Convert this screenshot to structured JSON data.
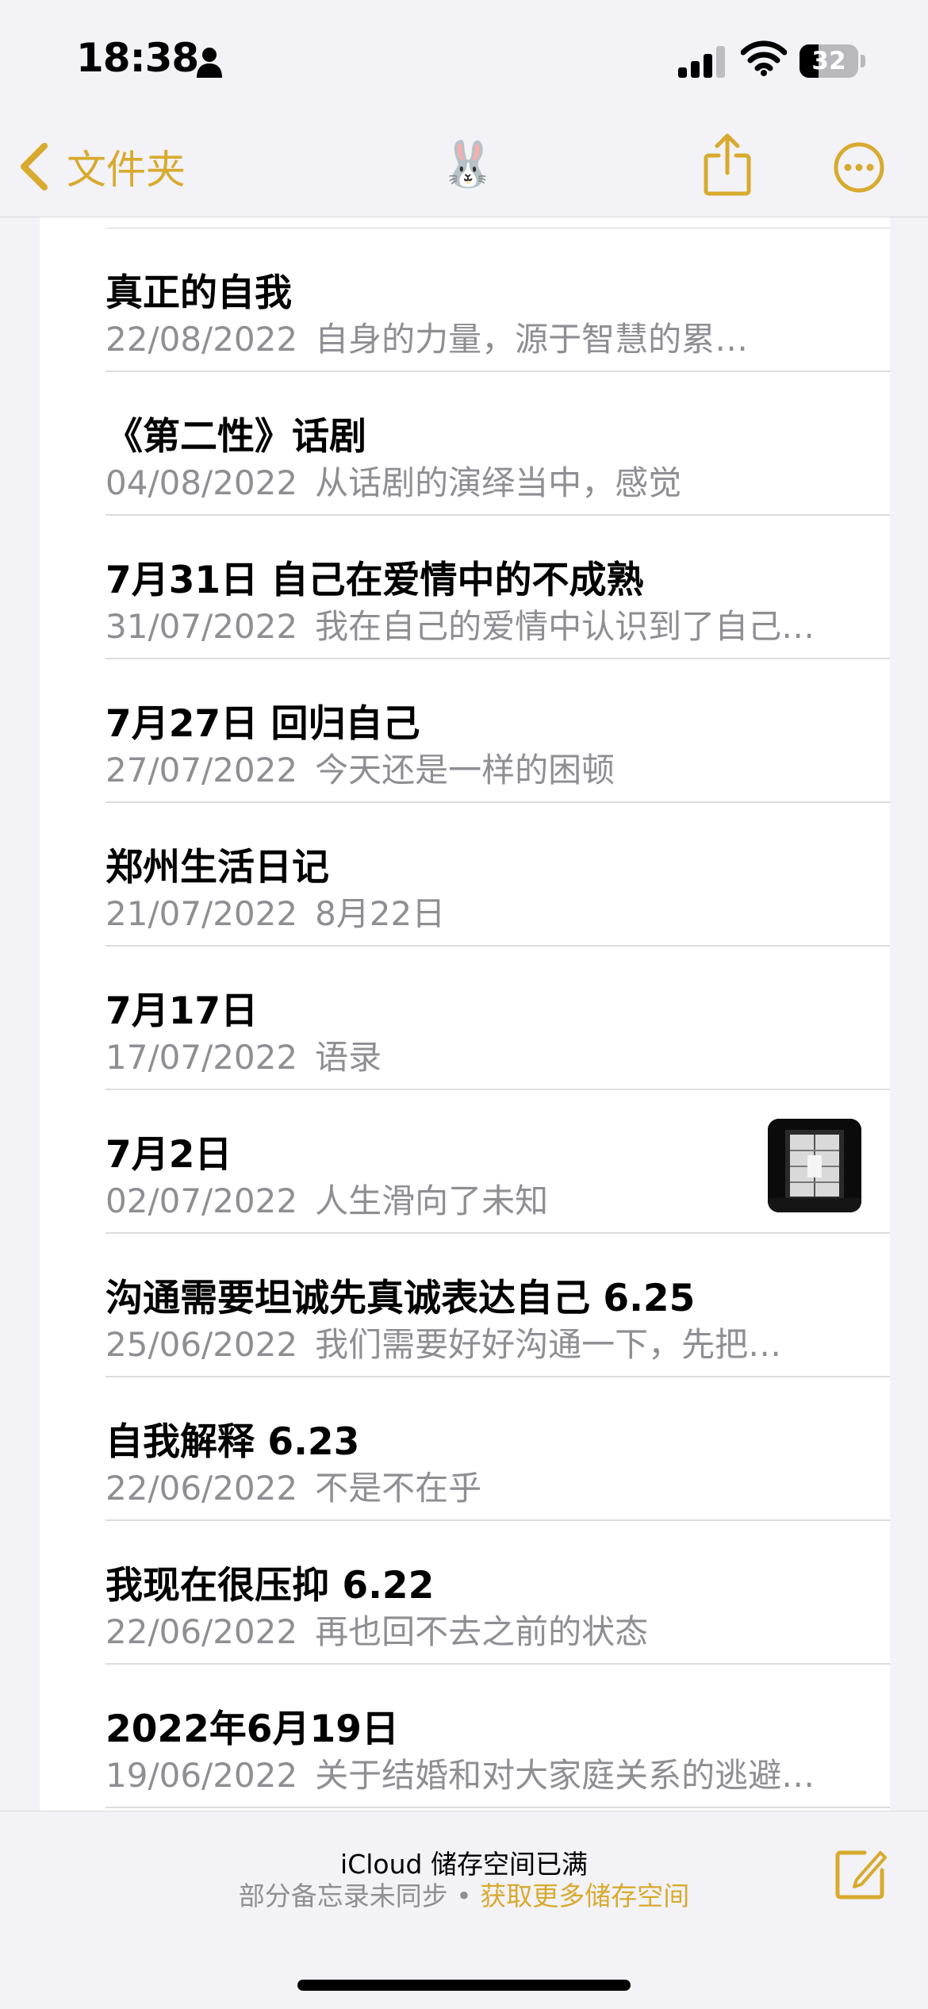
{
  "status_bar": {
    "time": "18:38",
    "battery": "32",
    "battery_level": 0.32,
    "icons": [
      "person-icon",
      "signal-icon",
      "wifi-icon",
      "battery-icon"
    ]
  },
  "nav": {
    "back_label": "文件夹",
    "title_emoji": "🐰",
    "share_icon": "share-icon",
    "more_icon": "ellipsis-circle-icon",
    "accent_color": "#d8aa2d"
  },
  "notes": [
    {
      "title": "真正的自我",
      "date": "22/08/2022",
      "preview": "自身的力量，源于智慧的累…"
    },
    {
      "title": "《第二性》话剧",
      "date": "04/08/2022",
      "preview": "从话剧的演绎当中，感觉"
    },
    {
      "title": "7月31日 自己在爱情中的不成熟",
      "date": "31/07/2022",
      "preview": "我在自己的爱情中认识到了自己…"
    },
    {
      "title": "7月27日 回归自己",
      "date": "27/07/2022",
      "preview": "今天还是一样的困顿"
    },
    {
      "title": "郑州生活日记",
      "date": "21/07/2022",
      "preview": "8月22日"
    },
    {
      "title": "7月17日",
      "date": "17/07/2022",
      "preview": "语录"
    },
    {
      "title": "7月2日",
      "date": "02/07/2022",
      "preview": "人生滑向了未知",
      "has_thumbnail": true
    },
    {
      "title": "沟通需要坦诚先真诚表达自己 6.25",
      "date": "25/06/2022",
      "preview": "我们需要好好沟通一下，先把…"
    },
    {
      "title": "自我解释 6.23",
      "date": "22/06/2022",
      "preview": "不是不在乎"
    },
    {
      "title": "我现在很压抑 6.22",
      "date": "22/06/2022",
      "preview": "再也回不去之前的状态"
    },
    {
      "title": "2022年6月19日",
      "date": "19/06/2022",
      "preview": "关于结婚和对大家庭关系的逃避…"
    }
  ],
  "bottom": {
    "storage_title": "iCloud 储存空间已满",
    "storage_sub": "部分备忘录未同步 • ",
    "storage_link": "获取更多储存空间",
    "compose_icon": "compose-icon"
  }
}
